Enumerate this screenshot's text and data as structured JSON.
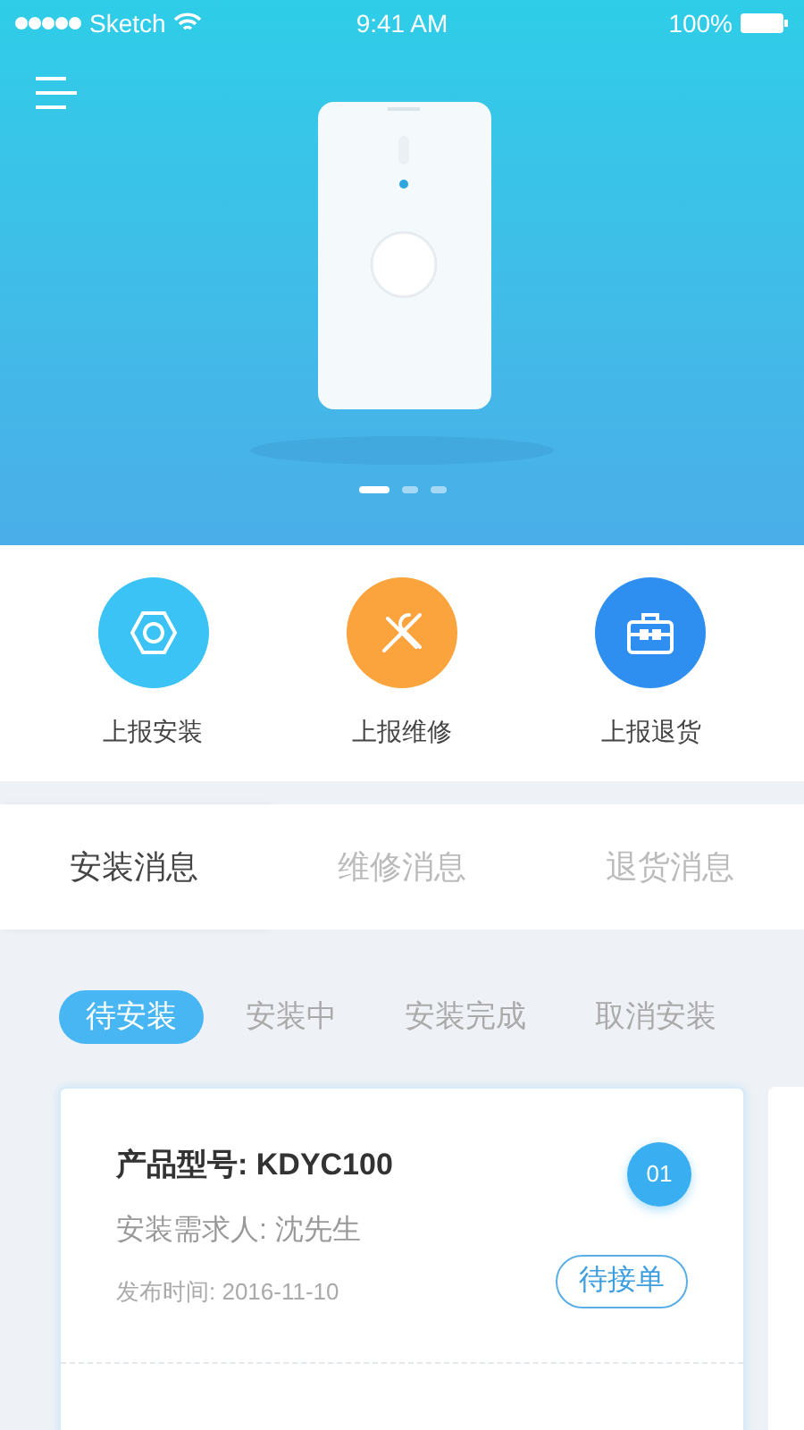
{
  "status_bar": {
    "carrier": "Sketch",
    "time": "9:41 AM",
    "battery": "100%"
  },
  "carousel": {
    "pages": [
      {
        "selected": true
      },
      {
        "selected": false
      },
      {
        "selected": false
      }
    ]
  },
  "actions": [
    {
      "label": "上报安装",
      "kind": "install",
      "color": "#3cc3f5"
    },
    {
      "label": "上报维修",
      "kind": "repair",
      "color": "#fba33c"
    },
    {
      "label": "上报退货",
      "kind": "return",
      "color": "#2f8ff0"
    }
  ],
  "tabs": [
    {
      "label": "安装消息",
      "selected": true
    },
    {
      "label": "维修消息",
      "selected": false
    },
    {
      "label": "退货消息",
      "selected": false
    }
  ],
  "filters": [
    {
      "label": "待安装",
      "selected": true
    },
    {
      "label": "安装中",
      "selected": false
    },
    {
      "label": "安装完成",
      "selected": false
    },
    {
      "label": "取消安装",
      "selected": false
    }
  ],
  "orders": [
    {
      "model": "产品型号: KDYC100",
      "requester": "安装需求人: 沈先生",
      "published": "发布时间: 2016-11-10",
      "number": "01",
      "status": "待接单"
    }
  ]
}
